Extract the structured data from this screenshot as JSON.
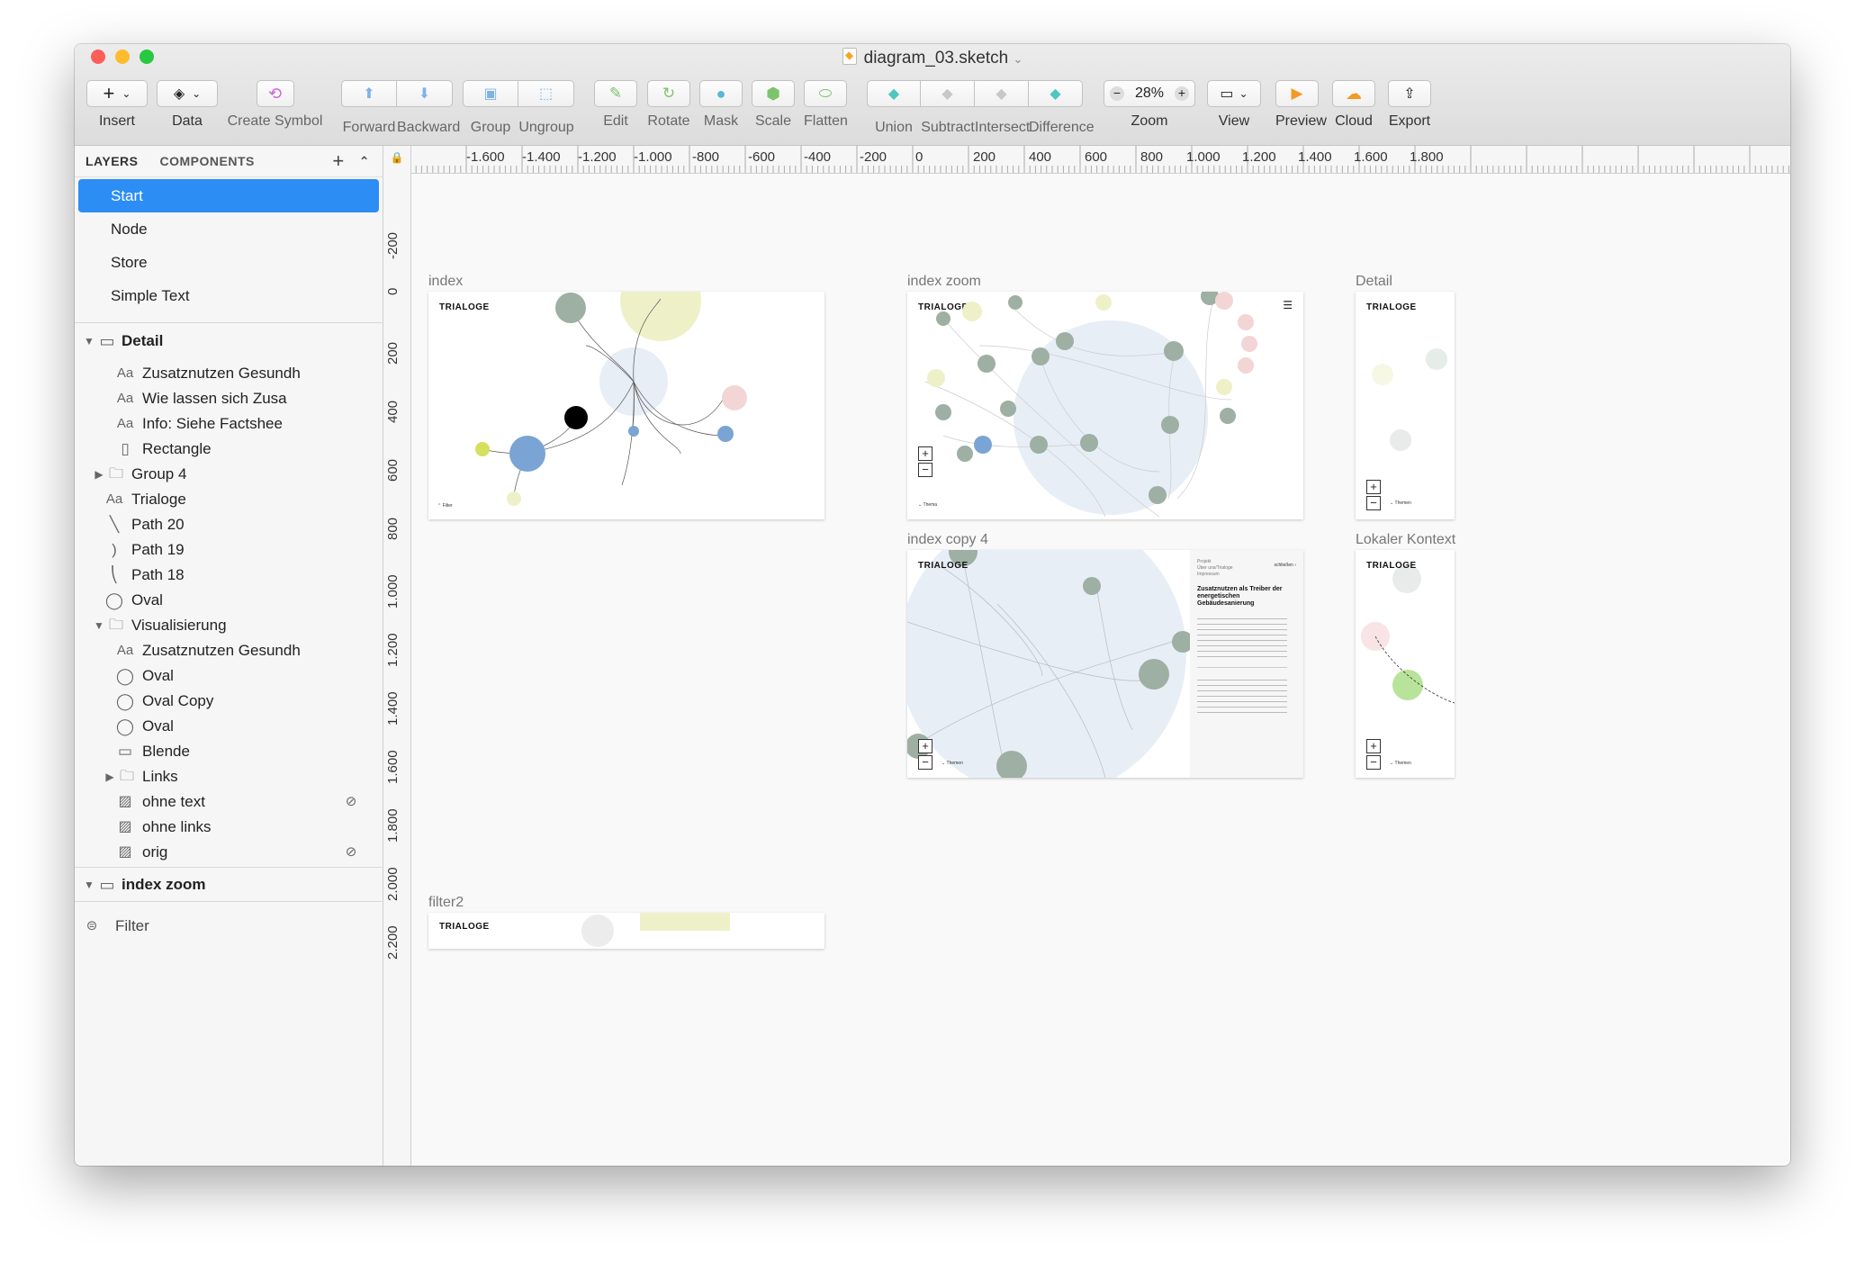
{
  "window": {
    "title": "diagram_03.sketch"
  },
  "toolbar": {
    "insert": "Insert",
    "data": "Data",
    "create_symbol": "Create Symbol",
    "forward": "Forward",
    "backward": "Backward",
    "group": "Group",
    "ungroup": "Ungroup",
    "edit": "Edit",
    "rotate": "Rotate",
    "mask": "Mask",
    "scale": "Scale",
    "flatten": "Flatten",
    "union": "Union",
    "subtract": "Subtract",
    "intersect": "Intersect",
    "difference": "Difference",
    "zoom_label": "Zoom",
    "zoom_value": "28%",
    "view": "View",
    "preview": "Preview",
    "cloud": "Cloud",
    "export": "Export"
  },
  "sidebar": {
    "tab_layers": "LAYERS",
    "tab_components": "COMPONENTS",
    "pages": [
      "Start",
      "Node",
      "Store",
      "Simple Text"
    ],
    "detail_group": "Detail",
    "layers": [
      {
        "icon": "text-icon",
        "label": "Zusatznutzen Gesundh"
      },
      {
        "icon": "text-icon",
        "label": "Wie lassen sich Zusa"
      },
      {
        "icon": "text-icon",
        "label": "Info: Siehe Factshee"
      },
      {
        "icon": "rectangle-icon",
        "label": "Rectangle"
      },
      {
        "icon": "folder-icon",
        "label": "Group 4"
      },
      {
        "icon": "text-icon",
        "label": "Trialoge"
      },
      {
        "icon": "path-icon",
        "label": "Path 20"
      },
      {
        "icon": "path-icon",
        "label": "Path 19"
      },
      {
        "icon": "path-icon",
        "label": "Path 18"
      },
      {
        "icon": "oval-icon",
        "label": "Oval"
      },
      {
        "icon": "folder-icon",
        "label": "Visualisierung"
      },
      {
        "icon": "text-icon",
        "label": "Zusatznutzen Gesundh"
      },
      {
        "icon": "oval-icon",
        "label": "Oval"
      },
      {
        "icon": "oval-icon",
        "label": "Oval Copy"
      },
      {
        "icon": "oval-icon",
        "label": "Oval"
      },
      {
        "icon": "rectangle-icon",
        "label": "Blende"
      },
      {
        "icon": "folder-icon",
        "label": "Links"
      },
      {
        "icon": "image-icon",
        "label": "ohne text"
      },
      {
        "icon": "image-icon",
        "label": "ohne links"
      },
      {
        "icon": "image-icon",
        "label": "orig"
      }
    ],
    "index_zoom_group": "index zoom",
    "filter": "Filter"
  },
  "rulers": {
    "horizontal": [
      "-1.600",
      "-1.400",
      "-1.200",
      "-1.000",
      "-800",
      "-600",
      "-400",
      "-200",
      "0",
      "200",
      "400",
      "600",
      "800",
      "1.000",
      "1.200",
      "1.400",
      "1.600",
      "1.800"
    ],
    "vertical": [
      "-200",
      "0",
      "200",
      "400",
      "600",
      "800",
      "1.000",
      "1.200",
      "1.400",
      "1.600",
      "1.800",
      "2.000",
      "2.200"
    ]
  },
  "artboards": {
    "index": "index",
    "index_zoom": "index zoom",
    "detail": "Detail",
    "index_copy_4": "index copy 4",
    "lokaler_kontext": "Lokaler Kontext",
    "filter2": "filter2",
    "brand": "TRIALOGE",
    "filter_label": "Filter",
    "thema_label": "Thema",
    "themen_label": "Themen",
    "zoom_plus": "+",
    "zoom_minus": "−",
    "panel_heading": "Zusatznutzen als Treiber der energetischen Gebäudesanierung",
    "panel_nav": [
      "Projekt",
      "Über uns/Trialoge",
      "Impressum"
    ],
    "panel_close": "schließen"
  }
}
